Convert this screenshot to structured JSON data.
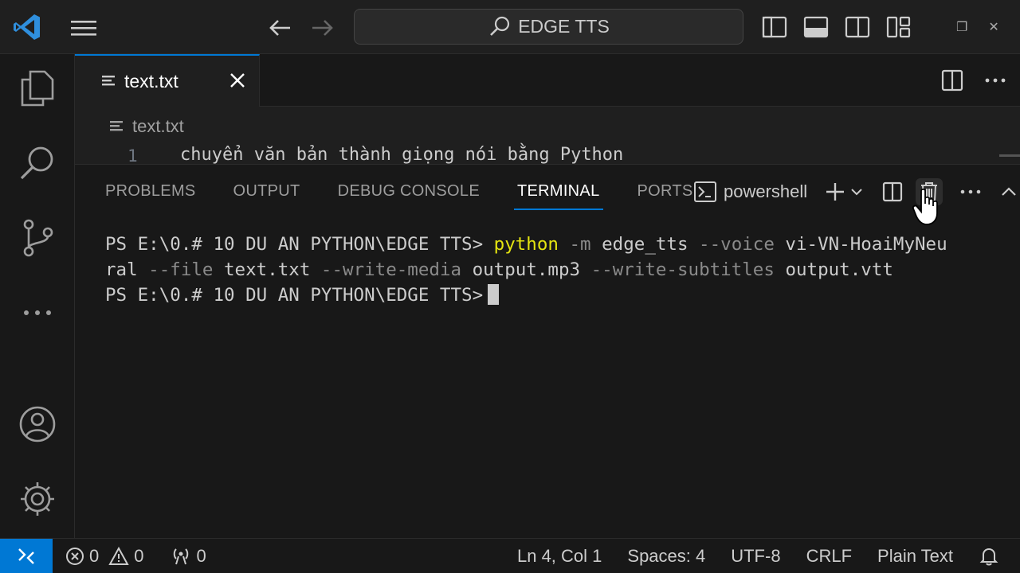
{
  "titlebar": {
    "search_text": "EDGE TTS"
  },
  "tab": {
    "label": "text.txt"
  },
  "breadcrumb": {
    "file": "text.txt"
  },
  "editor": {
    "line_number": "1",
    "line_text": "chuyển văn bản thành giọng nói bằng Python"
  },
  "panel": {
    "tabs": [
      "PROBLEMS",
      "OUTPUT",
      "DEBUG CONSOLE",
      "TERMINAL",
      "PORTS"
    ],
    "active_tab": "TERMINAL",
    "shell": "powershell"
  },
  "terminal": {
    "prompt": "PS E:\\0.# 10 DU AN PYTHON\\EDGE TTS> ",
    "cmd": "python",
    "p1": " -m",
    "p2": " edge_tts",
    "p3": " --voice",
    "p4": " vi-VN-HoaiMyNeu",
    "p5": "ral",
    "p6": " --file",
    "p7": " text.txt",
    "p8": " --write-media",
    "p9": " output.mp3",
    "p10": " --write-subtitles",
    "p11": " output.vtt",
    "prompt2": "PS E:\\0.# 10 DU AN PYTHON\\EDGE TTS>"
  },
  "status": {
    "errors": "0",
    "warnings": "0",
    "ports": "0",
    "position": "Ln 4, Col 1",
    "spaces": "Spaces: 4",
    "encoding": "UTF-8",
    "eol": "CRLF",
    "language": "Plain Text"
  },
  "colors": {
    "accent": "#0078d4",
    "command": "#e5e510",
    "flag": "#8a8a8a"
  }
}
